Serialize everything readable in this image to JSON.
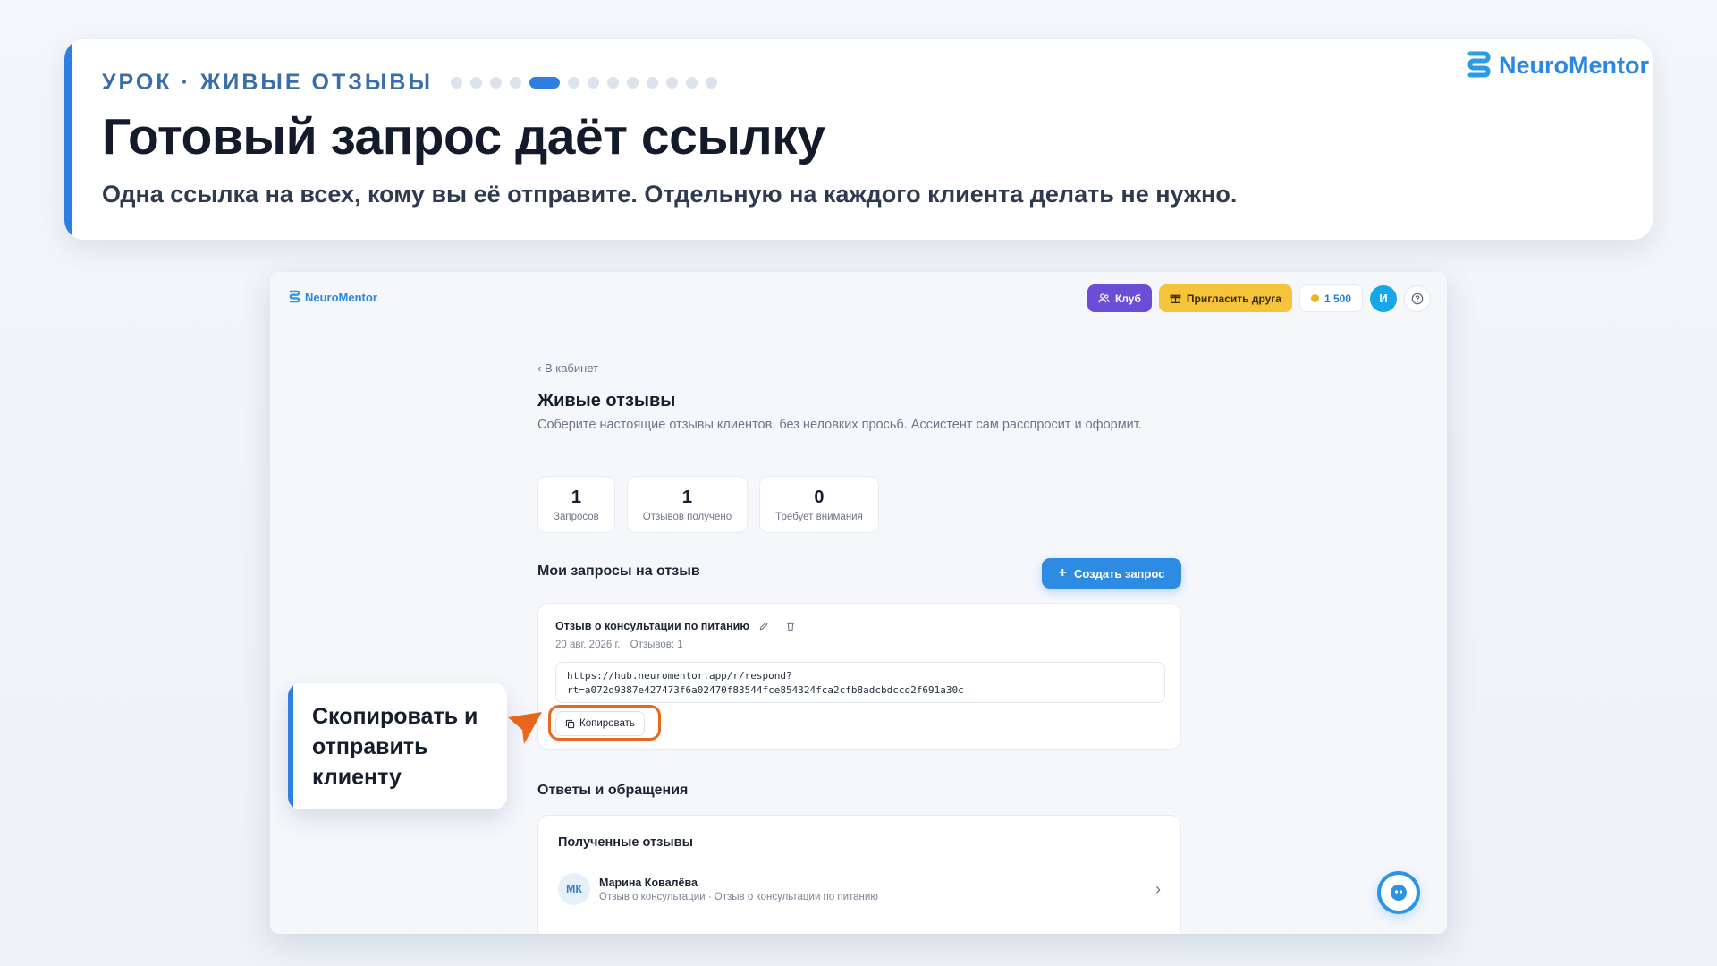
{
  "lesson": {
    "label": "УРОК · ЖИВЫЕ ОТЗЫВЫ",
    "progress": {
      "total": 13,
      "current": 5
    },
    "title": "Готовый запрос даёт ссылку",
    "subtitle": "Одна ссылка на всех, кому вы её отправите. Отдельную на каждого клиента делать не нужно.",
    "brand": "NeuroMentor"
  },
  "app": {
    "brand": "NeuroMentor",
    "topbar": {
      "club_label": "Клуб",
      "invite_label": "Пригласить друга",
      "coins": "1 500",
      "avatar_initial": "И"
    },
    "back_link": "‹ В кабинет",
    "page_title": "Живые отзывы",
    "page_description": "Соберите настоящие отзывы клиентов, без неловких просьб. Ассистент сам расспросит и оформит.",
    "stats": [
      {
        "value": "1",
        "label": "Запросов"
      },
      {
        "value": "1",
        "label": "Отзывов получено"
      },
      {
        "value": "0",
        "label": "Требует внимания"
      }
    ],
    "requests_section_title": "Мои запросы на отзыв",
    "create_button_label": "Создать запрос",
    "request": {
      "title": "Отзыв о консультации по питанию",
      "date": "20 авг. 2026 г.",
      "reviews_count": "Отзывов: 1",
      "link_line1": "https://hub.neuromentor.app/r/respond?",
      "link_line2": "rt=a072d9387e427473f6a02470f83544fce854324fca2cfb8adcbdccd2f691a30c",
      "copy_label": "Копировать"
    },
    "responses_section_title": "Ответы и обращения",
    "received": {
      "title": "Полученные отзывы",
      "items": [
        {
          "initials": "МК",
          "name": "Марина Ковалёва",
          "detail": "Отзыв о консультации · Отзыв о консультации по питанию"
        }
      ]
    }
  },
  "callout": {
    "text": "Скопировать и отправить клиенту"
  },
  "colors": {
    "accent": "#2f7fe0",
    "highlight": "#e9671c",
    "club": "#6a4fd6",
    "invite": "#f5c43b"
  }
}
